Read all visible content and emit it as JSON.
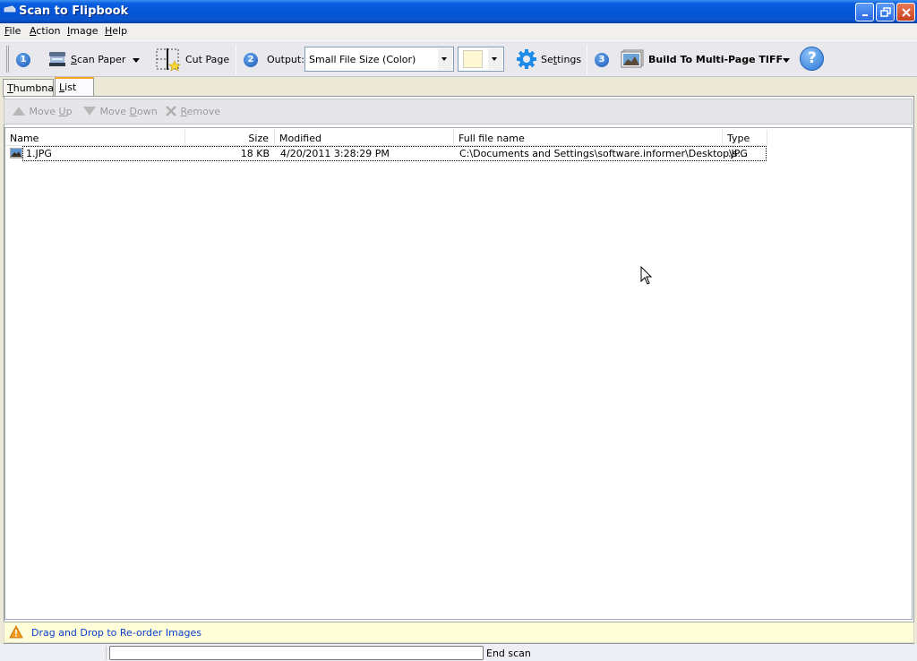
{
  "window": {
    "title": "Scan to Flipbook",
    "controls": {
      "minimize": "minimize",
      "maximize": "restore",
      "close": "close"
    }
  },
  "menu": {
    "items": [
      {
        "label": "File",
        "accel": "F",
        "rest": "ile"
      },
      {
        "label": "Action",
        "accel": "A",
        "rest": "ction"
      },
      {
        "label": "Image",
        "accel": "I",
        "rest": "mage"
      },
      {
        "label": "Help",
        "accel": "H",
        "rest": "elp"
      }
    ]
  },
  "toolbar": {
    "step1": "1",
    "scan_paper": {
      "accel": "S",
      "rest": "can Paper",
      "icon": "scanner-icon"
    },
    "cut_page": {
      "label": "Cut Page",
      "icon": "cut-page-icon"
    },
    "step2": "2",
    "output_label": "Output:",
    "output_value": "Small File Size (Color)",
    "color_swatch": "#fff8d2",
    "settings": {
      "pre": "Se",
      "accel": "t",
      "rest": "tings",
      "icon": "gear-icon"
    },
    "step3": "3",
    "build": {
      "label": "Build To Multi-Page TIFF",
      "icon": "picture-icon"
    },
    "help_icon": "?"
  },
  "tabs": [
    {
      "label": "Thumbnail",
      "accel": "T",
      "rest": "humbnail",
      "active": false
    },
    {
      "label": "List",
      "accel": "L",
      "rest": "ist",
      "active": true
    }
  ],
  "list_toolbar": {
    "move_up": {
      "pre": "Move ",
      "accel": "U",
      "rest": "p"
    },
    "move_down": {
      "pre": "Move ",
      "accel": "D",
      "rest": "own"
    },
    "remove": {
      "pre": "",
      "accel": "R",
      "rest": "emove"
    }
  },
  "file_list": {
    "columns": [
      "Name",
      "Size",
      "Modified",
      "Full file name",
      "Type"
    ],
    "rows": [
      {
        "name": "1.JPG",
        "size": "18 KB",
        "modified": "4/20/2011 3:28:29 PM",
        "full_name": "C:\\Documents and Settings\\software.informer\\Desktop\\s...",
        "type": ".JPG"
      }
    ]
  },
  "hint": {
    "text": "Drag and Drop to Re-order Images",
    "icon": "warning-icon"
  },
  "status": {
    "field_value": "",
    "text": "End scan"
  },
  "colors": {
    "titlebar": "#0556d8",
    "hint_bg": "#fffed8",
    "hint_text": "#0b3ecf",
    "tab_active_accent": "#f5a623"
  }
}
